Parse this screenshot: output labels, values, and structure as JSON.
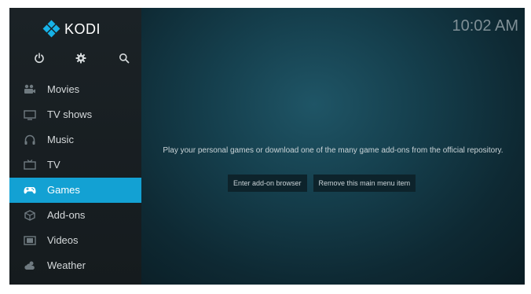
{
  "brand": {
    "name": "KODI",
    "accent_color": "#17b2e7"
  },
  "clock": {
    "time": "10:02 AM"
  },
  "top_icons": [
    {
      "name": "power-icon"
    },
    {
      "name": "gear-icon"
    },
    {
      "name": "search-icon"
    }
  ],
  "sidebar": {
    "active_color": "#13a1d3",
    "items": [
      {
        "label": "Movies",
        "icon": "movies-icon"
      },
      {
        "label": "TV shows",
        "icon": "tv-shows-icon"
      },
      {
        "label": "Music",
        "icon": "music-icon"
      },
      {
        "label": "TV",
        "icon": "tv-icon"
      },
      {
        "label": "Games",
        "icon": "gamepad-icon",
        "active": true
      },
      {
        "label": "Add-ons",
        "icon": "addons-icon"
      },
      {
        "label": "Videos",
        "icon": "videos-icon"
      },
      {
        "label": "Weather",
        "icon": "weather-icon"
      }
    ]
  },
  "main": {
    "message": "Play your personal games or download one of the many game add-ons from the official repository.",
    "buttons": {
      "addon_browser": "Enter add-on browser",
      "remove_item": "Remove this main menu item"
    }
  }
}
